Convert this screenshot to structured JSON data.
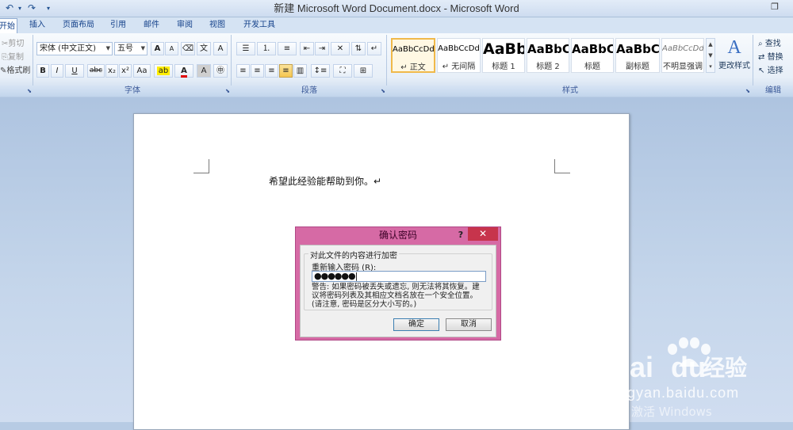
{
  "window": {
    "title": "新建 Microsoft Word Document.docx - Microsoft Word",
    "restore_glyph": "❐"
  },
  "quick_access": {
    "undo_glyph": "↶",
    "redo_glyph": "↷",
    "dropdown_glyph": "▾"
  },
  "tabs": [
    "开始",
    "插入",
    "页面布局",
    "引用",
    "邮件",
    "审阅",
    "视图",
    "开发工具"
  ],
  "clipboard": {
    "cut": "剪切",
    "copy": "复制",
    "format_painter": "格式刷"
  },
  "font": {
    "name": "宋体 (中文正文)",
    "size": "五号",
    "group_label": "字体",
    "buttons": [
      "B",
      "I",
      "U",
      "abc",
      "x₂",
      "x²",
      "Aa"
    ],
    "grow": "A",
    "shrink": "A"
  },
  "paragraph": {
    "group_label": "段落"
  },
  "styles": {
    "group_label": "样式",
    "items": [
      {
        "preview": "AaBbCcDd",
        "name": "↵ 正文"
      },
      {
        "preview": "AaBbCcDd",
        "name": "↵ 无间隔"
      },
      {
        "preview": "AaBb",
        "name": "标题 1"
      },
      {
        "preview": "AaBbC",
        "name": "标题 2"
      },
      {
        "preview": "AaBbC",
        "name": "标题"
      },
      {
        "preview": "AaBbC",
        "name": "副标题"
      },
      {
        "preview": "AaBbCcDd",
        "name": "不明显强调"
      }
    ],
    "change_styles": "更改样式"
  },
  "editing": {
    "group_label": "编辑",
    "find": "查找",
    "replace": "替换",
    "select": "选择"
  },
  "document": {
    "text": "希望此经验能帮助到你。↵"
  },
  "dialog": {
    "title": "确认密码",
    "help": "?",
    "close": "✕",
    "group_label": "对此文件的内容进行加密",
    "reenter_label": "重新输入密码 (R):",
    "password_mask": "●●●●●●|",
    "warning_line1": "警告: 如果密码被丢失或遗忘, 则无法将其恢复。建",
    "warning_line2": "议将密码列表及其相应文档名放在一个安全位置。",
    "warning_line3": "(请注意, 密码是区分大小写的。)",
    "ok": "确定",
    "cancel": "取消"
  },
  "watermark": {
    "brand": "Bai",
    "brand2": "du",
    "brand_cn": "经验",
    "url": "jingyan.baidu.com",
    "activate": "激活 Windows"
  }
}
